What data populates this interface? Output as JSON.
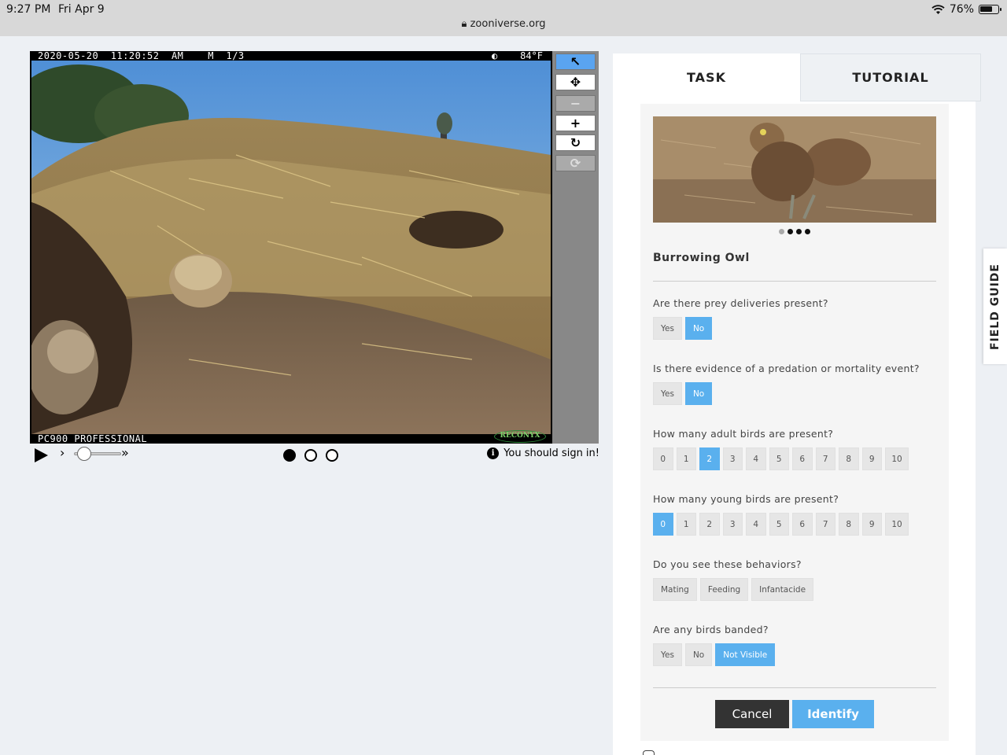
{
  "status_bar": {
    "time": "9:27 PM",
    "date": "Fri Apr 9",
    "battery": "76%",
    "battery_level": 0.76
  },
  "browser": {
    "url": "zooniverse.org"
  },
  "camera": {
    "stamp": "2020-05-20  11:20:52  AM    M  1/3",
    "temp": "◐    84°F",
    "model": "PC900 PROFESSIONAL",
    "logo": "RECONYX"
  },
  "toolbar": {
    "tools": [
      {
        "name": "pointer-icon",
        "glyph": "↖"
      },
      {
        "name": "pan-icon",
        "glyph": "✥"
      },
      {
        "name": "zoom-out-icon",
        "glyph": "−"
      },
      {
        "name": "zoom-in-icon",
        "glyph": "+"
      },
      {
        "name": "rotate-icon",
        "glyph": "↻"
      },
      {
        "name": "reset-icon",
        "glyph": "⟳"
      }
    ]
  },
  "player": {
    "slow_glyph": "›",
    "fast_glyph": "»",
    "frames": 3,
    "current_frame": 1,
    "signin_text": "You should sign in!",
    "info_glyph": "i"
  },
  "tabs": {
    "task": "TASK",
    "tutorial": "TUTORIAL"
  },
  "choice": {
    "name": "Burrowing Owl",
    "carousel_active": 1,
    "carousel_count": 4
  },
  "questions": [
    {
      "text": "Are there prey deliveries present?",
      "options": [
        "Yes",
        "No"
      ],
      "selected": [
        "No"
      ]
    },
    {
      "text": "Is there evidence of a predation or mortality event?",
      "options": [
        "Yes",
        "No"
      ],
      "selected": [
        "No"
      ]
    },
    {
      "text": "How many adult birds are present?",
      "options": [
        "0",
        "1",
        "2",
        "3",
        "4",
        "5",
        "6",
        "7",
        "8",
        "9",
        "10"
      ],
      "selected": [
        "2"
      ]
    },
    {
      "text": "How many young birds are present?",
      "options": [
        "0",
        "1",
        "2",
        "3",
        "4",
        "5",
        "6",
        "7",
        "8",
        "9",
        "10"
      ],
      "selected": [
        "0"
      ]
    },
    {
      "text": "Do you see these behaviors?",
      "options": [
        "Mating",
        "Feeding",
        "Infantacide"
      ],
      "selected": []
    },
    {
      "text": "Are any birds banded?",
      "options": [
        "Yes",
        "No",
        "Not Visible"
      ],
      "selected": [
        "Not Visible"
      ]
    }
  ],
  "actions": {
    "cancel": "Cancel",
    "identify": "Identify"
  },
  "field_guide": "FIELD GUIDE",
  "colors": {
    "accent": "#5ab0ee",
    "dark": "#333333",
    "tool_active": "#5aa4f0"
  }
}
